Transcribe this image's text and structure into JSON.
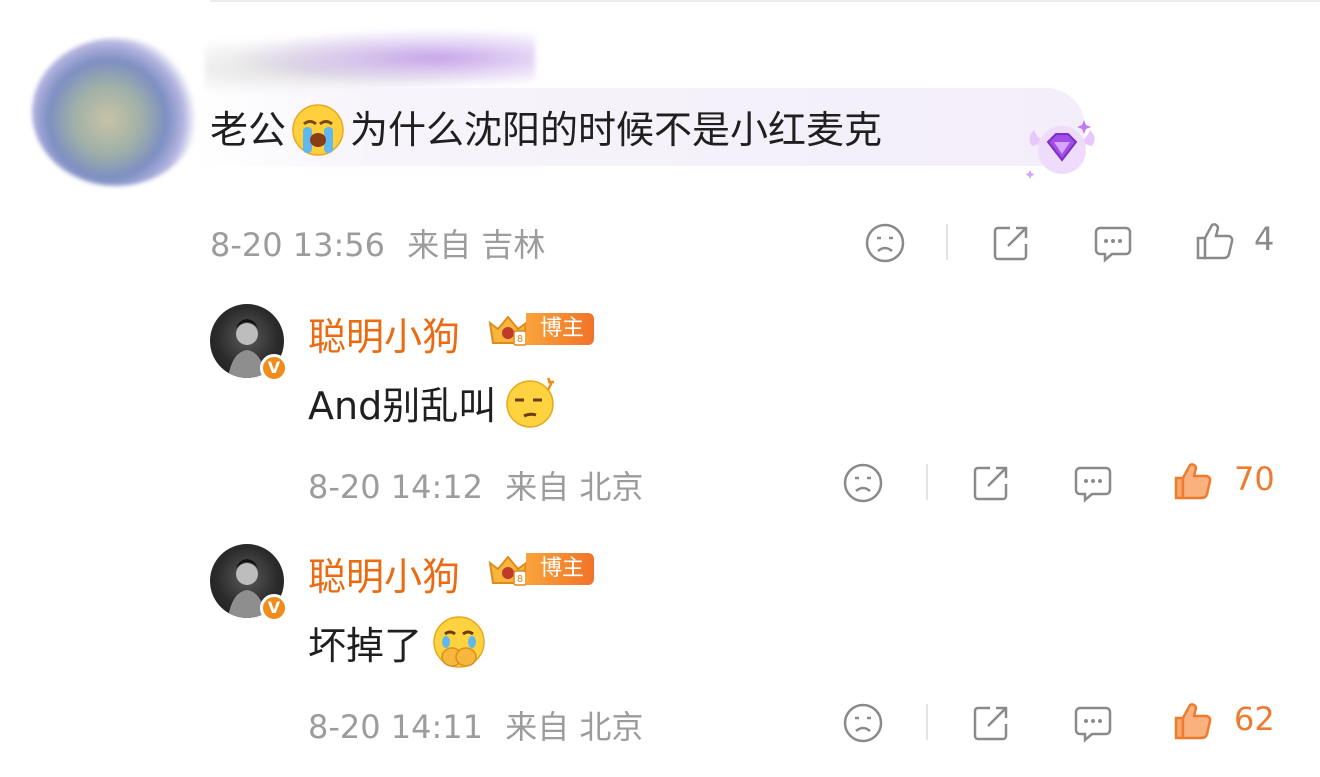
{
  "comment": {
    "text_before": "老公",
    "emoji": "crying-face-emoji",
    "text_after": "为什么沈阳的时候不是小红麦克",
    "badge_icon": "purple-gem-wings-badge",
    "date": "8-20 13:56",
    "source": "来自 吉林",
    "like_count": "4"
  },
  "replies": [
    {
      "author": "聪明小狗",
      "tag_label": "博主",
      "verified_mark": "V",
      "text": "And别乱叫",
      "emoji": "smirk-face-emoji",
      "date": "8-20 14:12",
      "source": "来自 北京",
      "like_count": "70"
    },
    {
      "author": "聪明小狗",
      "tag_label": "博主",
      "verified_mark": "V",
      "text": "坏掉了",
      "emoji": "crying-hands-face-emoji",
      "date": "8-20 14:11",
      "source": "来自 北京",
      "like_count": "62"
    }
  ],
  "colors": {
    "author": "#ec6b12",
    "like_active": "#ef7b2e",
    "meta_gray": "#9c9c9c"
  }
}
